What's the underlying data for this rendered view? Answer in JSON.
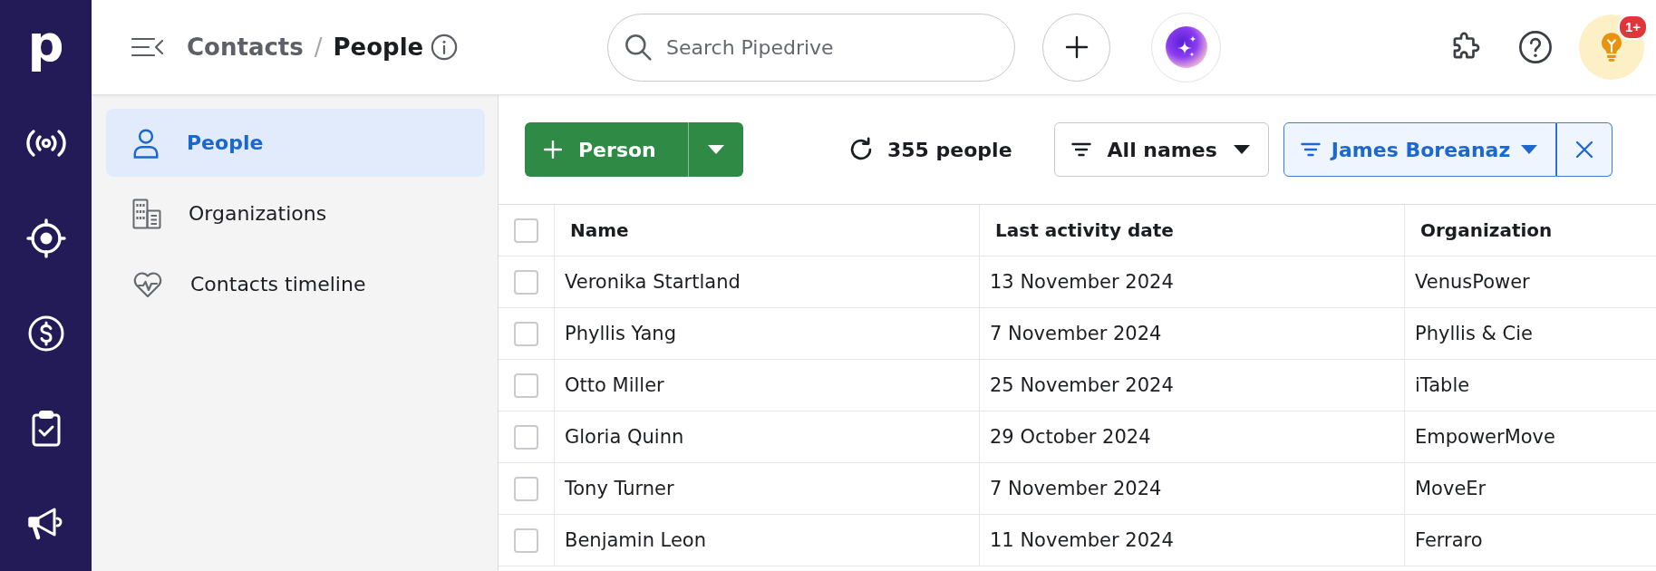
{
  "nav_rail": {
    "logo": "p"
  },
  "top_bar": {
    "breadcrumb": [
      {
        "label": "Contacts",
        "current": false
      },
      {
        "label": "People",
        "current": true
      }
    ],
    "separator": "/",
    "search": {
      "placeholder": "Search Pipedrive"
    },
    "tips_badge": "1+"
  },
  "sidebar": {
    "items": [
      {
        "label": "People",
        "selected": true
      },
      {
        "label": "Organizations",
        "selected": false
      },
      {
        "label": "Contacts timeline",
        "selected": false
      }
    ]
  },
  "toolbar": {
    "add_button": {
      "label": "Person"
    },
    "count": "355 people",
    "filters": [
      {
        "label": "All names",
        "active": false
      },
      {
        "label": "James Boreanaz",
        "active": true
      }
    ]
  },
  "table": {
    "select_all": {
      "checked": false
    },
    "columns": [
      "Name",
      "Last activity date",
      "Organization"
    ],
    "rows": [
      {
        "checked": false,
        "cells": [
          "Veronika Startland",
          "13 November 2024",
          "VenusPower"
        ]
      },
      {
        "checked": false,
        "cells": [
          "Phyllis Yang",
          "7 November 2024",
          "Phyllis & Cie"
        ]
      },
      {
        "checked": false,
        "cells": [
          "Otto Miller",
          "25 November 2024",
          "iTable"
        ]
      },
      {
        "checked": false,
        "cells": [
          "Gloria Quinn",
          "29 October 2024",
          "EmpowerMove"
        ]
      },
      {
        "checked": false,
        "cells": [
          "Tony Turner",
          "7 November 2024",
          "MoveEr"
        ]
      },
      {
        "checked": false,
        "cells": [
          "Benjamin Leon",
          "11 November 2024",
          "Ferraro"
        ]
      }
    ]
  }
}
